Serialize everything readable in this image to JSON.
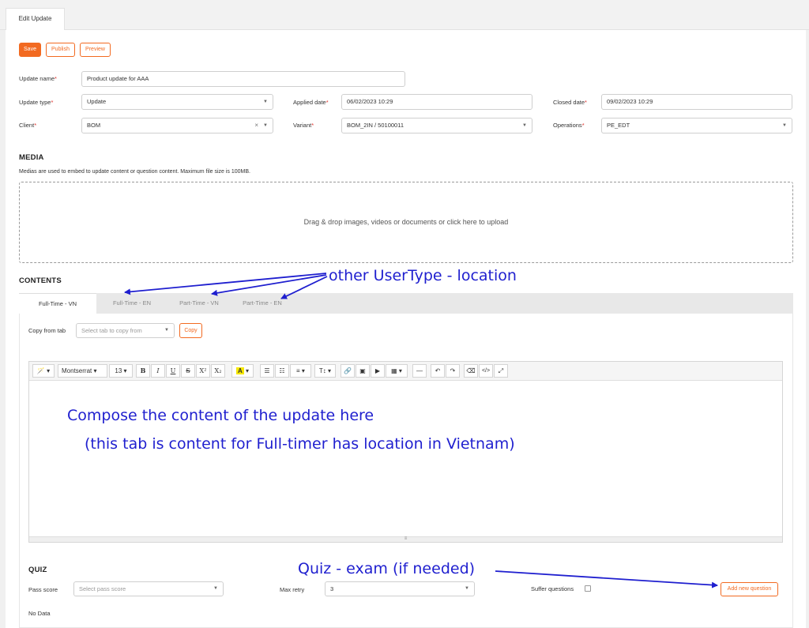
{
  "top_tab": "Edit Update",
  "buttons": {
    "save": "Save",
    "publish": "Publish",
    "preview": "Preview"
  },
  "form": {
    "update_name_label": "Update name",
    "update_name_value": "Product update for AAA",
    "update_type_label": "Update type",
    "update_type_value": "Update",
    "applied_date_label": "Applied date",
    "applied_date_value": "06/02/2023 10:29",
    "closed_date_label": "Closed date",
    "closed_date_value": "09/02/2023 10:29",
    "client_label": "Client",
    "client_value": "BOM",
    "variant_label": "Variant",
    "variant_value": "BOM_2IN / 50100011",
    "operations_label": "Operations",
    "operations_value": "PE_EDT",
    "required_mark": "*"
  },
  "media": {
    "title": "MEDIA",
    "description": "Medias are used to embed to update content or question content. Maximum file size is 100MB.",
    "dropzone_text": "Drag & drop images, videos or documents or click here to upload"
  },
  "contents": {
    "title": "CONTENTS",
    "tabs": [
      "Full-Time - VN",
      "Full-Time - EN",
      "Part-Time - VN",
      "Part-Time - EN"
    ],
    "copy_from_label": "Copy from tab",
    "copy_from_placeholder": "Select tab to copy from",
    "copy_button": "Copy"
  },
  "editor": {
    "font_family": "Montserrat",
    "font_size": "13",
    "tools": {
      "magic": "🪄",
      "bold": "B",
      "italic": "I",
      "underline": "U",
      "strike": "S",
      "superscript": "X²",
      "subscript": "X₂",
      "highlight": "A",
      "bullet_list": "☰",
      "ordered_list": "☷",
      "align": "≡",
      "text_style": "T↕",
      "link": "🔗",
      "image": "▣",
      "video": "▶",
      "table": "▦",
      "hr": "—",
      "undo": "↶",
      "redo": "↷",
      "clear_format": "⌫",
      "code": "</>",
      "fullscreen": "⤢"
    },
    "resize_grip": "≡"
  },
  "quiz": {
    "title": "QUIZ",
    "pass_score_label": "Pass score",
    "pass_score_placeholder": "Select pass score",
    "max_retry_label": "Max retry",
    "max_retry_value": "3",
    "suffer_label": "Suffer questions",
    "add_question_button": "Add new question",
    "no_data": "No Data"
  },
  "annotations": {
    "usertype": "other UserType - location",
    "compose_line1": "Compose the content of the update here",
    "compose_line2": "(this tab is content for Full-timer has location in Vietnam)",
    "quiz": "Quiz - exam (if needed)"
  },
  "colors": {
    "accent": "#f26a21",
    "annotation": "#1f1fcf",
    "required": "#e0312b"
  }
}
